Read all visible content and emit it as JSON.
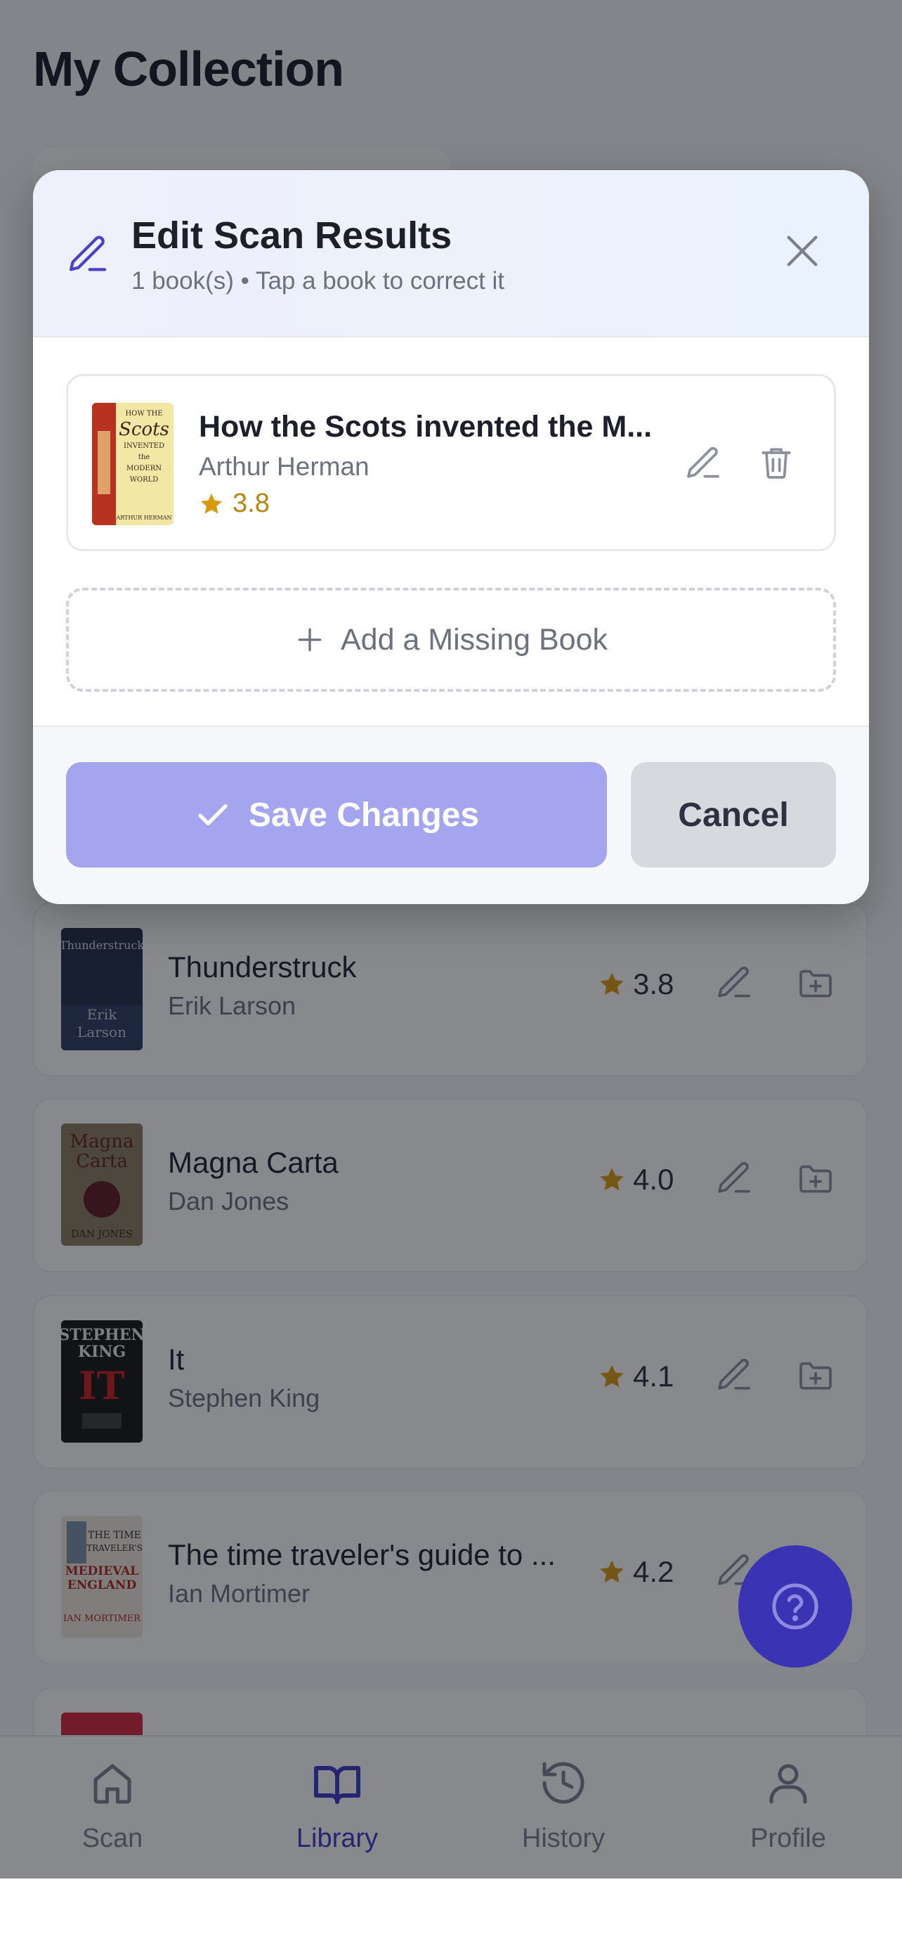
{
  "page": {
    "title": "My Collection"
  },
  "books": [
    {
      "title": "Thunderstruck",
      "author": "Erik Larson",
      "rating": "3.8"
    },
    {
      "title": "Magna Carta",
      "author": "Dan Jones",
      "rating": "4.0"
    },
    {
      "title": "It",
      "author": "Stephen King",
      "rating": "4.1"
    },
    {
      "title": "The time traveler's guide to ...",
      "author": "Ian Mortimer",
      "rating": "4.2"
    }
  ],
  "modal": {
    "title": "Edit Scan Results",
    "subtitle": "1 book(s) • Tap a book to correct it",
    "scanned_book": {
      "title": "How the Scots invented the M...",
      "author": "Arthur Herman",
      "rating": "3.8"
    },
    "add_missing_label": "Add a Missing Book",
    "save_label": "Save Changes",
    "cancel_label": "Cancel"
  },
  "tabs": [
    {
      "label": "Scan",
      "icon": "home-icon",
      "active": false
    },
    {
      "label": "Library",
      "icon": "book-open-icon",
      "active": true
    },
    {
      "label": "History",
      "icon": "history-icon",
      "active": false
    },
    {
      "label": "Profile",
      "icon": "user-icon",
      "active": false
    }
  ],
  "colors": {
    "accent": "#3d36c9",
    "save_button": "#a5a4ee",
    "star": "#d79a0c",
    "fab": "#3a33b3"
  }
}
